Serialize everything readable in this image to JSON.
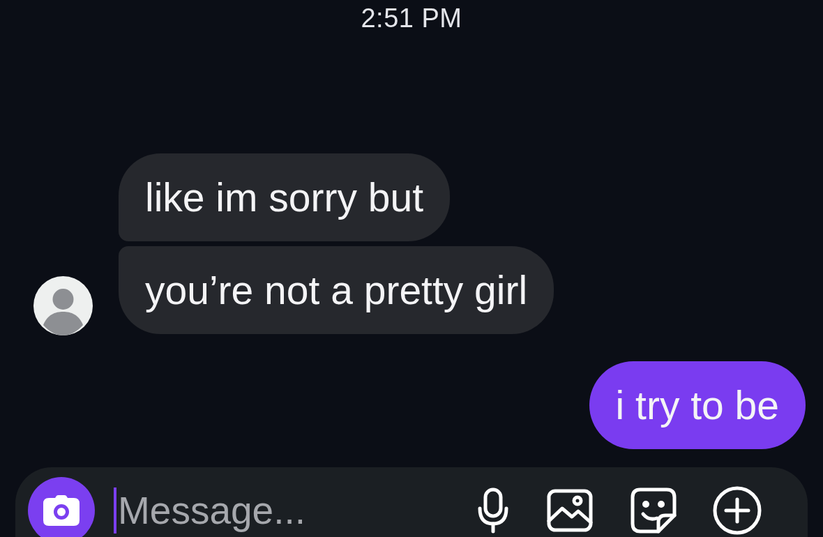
{
  "timestamp": "2:51 PM",
  "messages": [
    {
      "kind": "received",
      "text": "like im sorry but",
      "show_avatar": false
    },
    {
      "kind": "received",
      "text": "you’re not a pretty girl",
      "show_avatar": true
    },
    {
      "kind": "sent",
      "text": "i try to be"
    }
  ],
  "composer": {
    "placeholder": "Message..."
  }
}
